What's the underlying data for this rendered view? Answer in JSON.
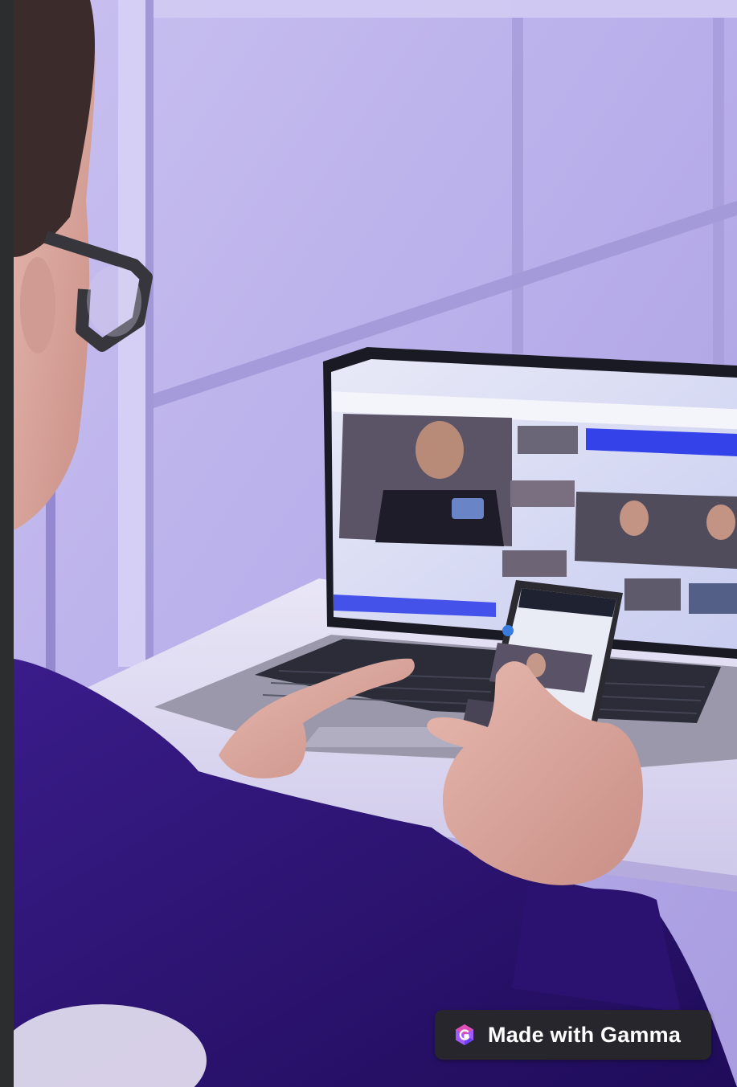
{
  "badge": {
    "label": "Made with Gamma",
    "logo_icon": "gamma-logo-icon",
    "accent": "#a259ff"
  },
  "colors": {
    "sidebar": "#2b2d2e",
    "wall": "#b9b0ea",
    "sweater": "#2b1270",
    "screen_accent": "#2a3ae8"
  }
}
